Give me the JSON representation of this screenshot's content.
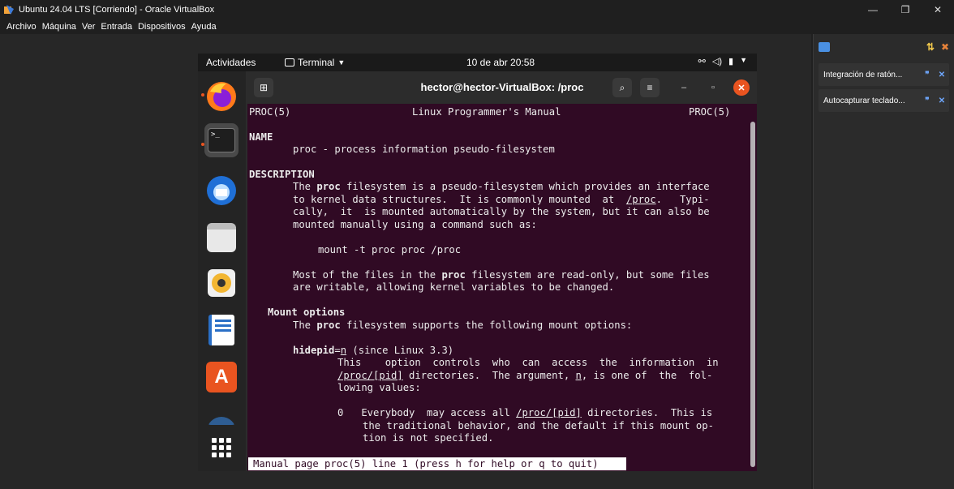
{
  "host": {
    "title": "Ubuntu 24.04 LTS [Corriendo] - Oracle VirtualBox",
    "menu": [
      "Archivo",
      "Máquina",
      "Ver",
      "Entrada",
      "Dispositivos",
      "Ayuda"
    ],
    "side_items": [
      "Integración de ratón...",
      "Autocapturar teclado..."
    ]
  },
  "guest": {
    "activities": "Actividades",
    "app_menu": "Terminal",
    "clock": "10 de abr  20:58"
  },
  "terminal": {
    "title": "hector@hector-VirtualBox: /proc",
    "status": "Manual page proc(5) line 1 (press h for help or q to quit)",
    "man": {
      "header_left": "PROC(5)",
      "header_center": "Linux Programmer's Manual",
      "header_right": "PROC(5)",
      "name_heading": "NAME",
      "name_line": "proc - process information pseudo-filesystem",
      "desc_heading": "DESCRIPTION",
      "mount_cmd": "mount -t proc proc /proc",
      "mount_opts_heading": "Mount options",
      "hidepid_since": " (since Linux 3.3)"
    }
  },
  "colors": {
    "terminal_bg": "#300a24",
    "ubuntu_orange": "#e95420"
  }
}
